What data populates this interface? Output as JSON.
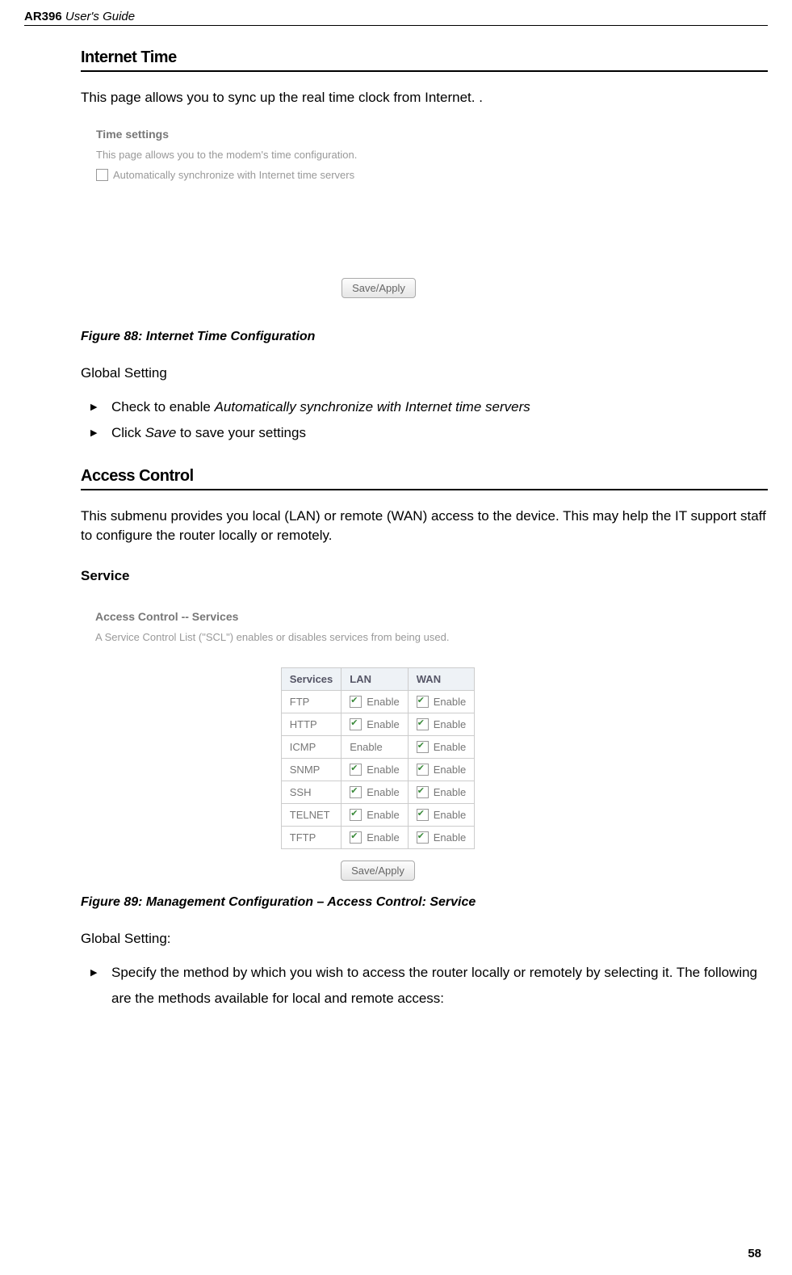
{
  "header": {
    "product": "AR396",
    "suffix": " User's Guide"
  },
  "s1": {
    "title": "Internet Time",
    "intro": "This page allows you to sync up the real time clock from Internet. .",
    "shot": {
      "h": "Time settings",
      "desc": "This page allows you to the modem's time configuration.",
      "chk_label": "Automatically synchronize with Internet time servers",
      "btn": "Save/Apply"
    },
    "caption": "Figure 88: Internet Time Configuration",
    "gs_label": "Global Setting",
    "b1_a": "Check to enable ",
    "b1_b": "Automatically synchronize with Internet time servers",
    "b2_a": "Click ",
    "b2_b": "Save",
    "b2_c": " to save your settings"
  },
  "s2": {
    "title": "Access Control",
    "intro": "This submenu provides you local (LAN) or remote (WAN) access to the device. This may help the IT support staff to configure the router locally or remotely.",
    "sub": "Service",
    "shot": {
      "h": "Access Control -- Services",
      "desc": "A Service Control List (\"SCL\") enables or disables services from being used.",
      "col1": "Services",
      "col2": "LAN",
      "col3": "WAN",
      "enable": "Enable",
      "rows": [
        {
          "name": "FTP",
          "lan_cb": true,
          "wan_cb": true
        },
        {
          "name": "HTTP",
          "lan_cb": true,
          "wan_cb": true
        },
        {
          "name": "ICMP",
          "lan_cb": false,
          "wan_cb": true
        },
        {
          "name": "SNMP",
          "lan_cb": true,
          "wan_cb": true
        },
        {
          "name": "SSH",
          "lan_cb": true,
          "wan_cb": true
        },
        {
          "name": "TELNET",
          "lan_cb": true,
          "wan_cb": true
        },
        {
          "name": "TFTP",
          "lan_cb": true,
          "wan_cb": true
        }
      ],
      "btn": "Save/Apply"
    },
    "caption": "Figure 89: Management Configuration – Access Control: Service",
    "gs_label": "Global Setting:",
    "b1": "Specify the method by which you wish to access the router locally or remotely by selecting it. The following are the methods available for local and remote access:"
  },
  "page_number": "58"
}
